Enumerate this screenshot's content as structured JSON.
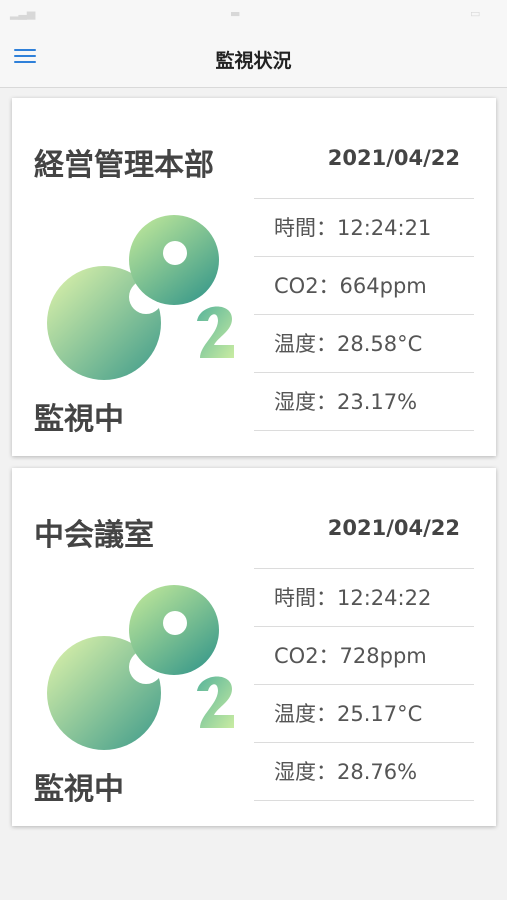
{
  "header": {
    "title": "監視状況"
  },
  "cards": [
    {
      "room": "経営管理本部",
      "date": "2021/04/22",
      "status": "監視中",
      "rows": [
        "時間：12:24:21",
        "CO2：664ppm",
        "温度：28.58°C",
        "湿度：23.17%"
      ]
    },
    {
      "room": "中会議室",
      "date": "2021/04/22",
      "status": "監視中",
      "rows": [
        "時間：12:24:22",
        "CO2：728ppm",
        "温度：25.17°C",
        "湿度：28.76%"
      ]
    }
  ],
  "colors": {
    "accent": "#2f80d9",
    "logo_light": "#d6f0a0",
    "logo_dark": "#3a9c8c"
  }
}
